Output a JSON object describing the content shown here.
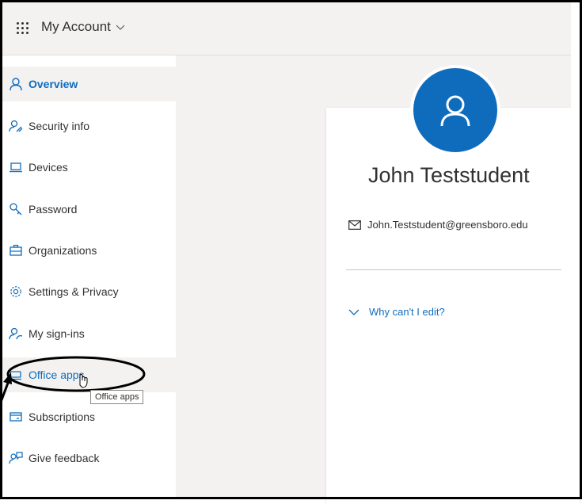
{
  "header": {
    "app_title": "My Account",
    "waffle_icon": "waffle-grid-icon",
    "chevron_icon": "chevron-down-icon"
  },
  "sidebar": {
    "items": [
      {
        "label": "Overview",
        "icon": "person-icon",
        "state": "active"
      },
      {
        "label": "Security info",
        "icon": "person-key-icon",
        "state": ""
      },
      {
        "label": "Devices",
        "icon": "laptop-icon",
        "state": ""
      },
      {
        "label": "Password",
        "icon": "key-icon",
        "state": ""
      },
      {
        "label": "Organizations",
        "icon": "briefcase-icon",
        "state": ""
      },
      {
        "label": "Settings & Privacy",
        "icon": "gear-icon",
        "state": ""
      },
      {
        "label": "My sign-ins",
        "icon": "person-sign-in-icon",
        "state": ""
      },
      {
        "label": "Office apps",
        "icon": "office-apps-icon",
        "state": "hover"
      },
      {
        "label": "Subscriptions",
        "icon": "card-icon",
        "state": ""
      },
      {
        "label": "Give feedback",
        "icon": "feedback-icon",
        "state": ""
      }
    ]
  },
  "tooltip": {
    "text": "Office apps"
  },
  "profile": {
    "name": "John Teststudent",
    "email": "John.Teststudent@greensboro.edu",
    "edit_link": "Why can't I edit?"
  },
  "colors": {
    "accent": "#0f6cbd",
    "header_bg": "#f3f2f1",
    "main_bg": "#f3f2f1"
  }
}
